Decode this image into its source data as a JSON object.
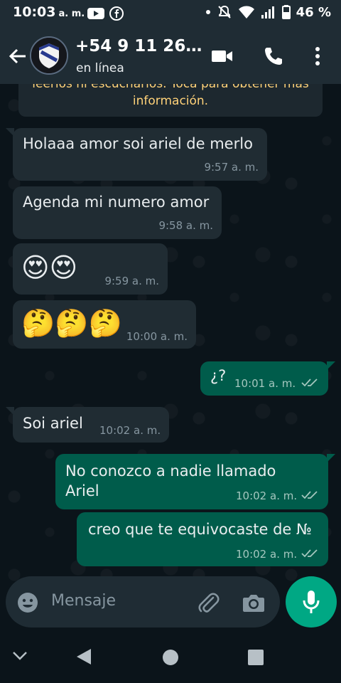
{
  "status_bar": {
    "time": "10:03",
    "ampm": "a. m.",
    "battery": "46 %"
  },
  "header": {
    "contact": "+54 9 11 26…",
    "status": "en línea"
  },
  "banner": {
    "line1": "leerlos ni escucharlos. Toca para obtener más",
    "line2": "información."
  },
  "messages": [
    {
      "dir": "in",
      "text": "Holaaa amor soi ariel de merlo",
      "time": "9:57 a. m."
    },
    {
      "dir": "in",
      "text": "Agenda mi numero amor",
      "time": "9:58 a. m."
    },
    {
      "dir": "in",
      "emoji": "😍😍",
      "time": "9:59 a. m."
    },
    {
      "dir": "in",
      "emoji": "🤔🤔🤔",
      "time": "10:00 a. m."
    },
    {
      "dir": "out",
      "text": "¿?",
      "time": "10:01 a. m."
    },
    {
      "dir": "in",
      "text": "Soi ariel",
      "time": "10:02 a. m."
    },
    {
      "dir": "out",
      "text_line1": "No conozco a nadie llamado",
      "text_line2": "Ariel",
      "time": "10:02 a. m."
    },
    {
      "dir": "out",
      "text": "creo que te equivocaste de №",
      "time": "10:02 a. m."
    }
  ],
  "composer": {
    "placeholder": "Mensaje"
  },
  "colors": {
    "incoming_bubble": "#202c33",
    "outgoing_bubble": "#005c4b",
    "accent": "#00a884",
    "banner_text": "#ffd279"
  }
}
